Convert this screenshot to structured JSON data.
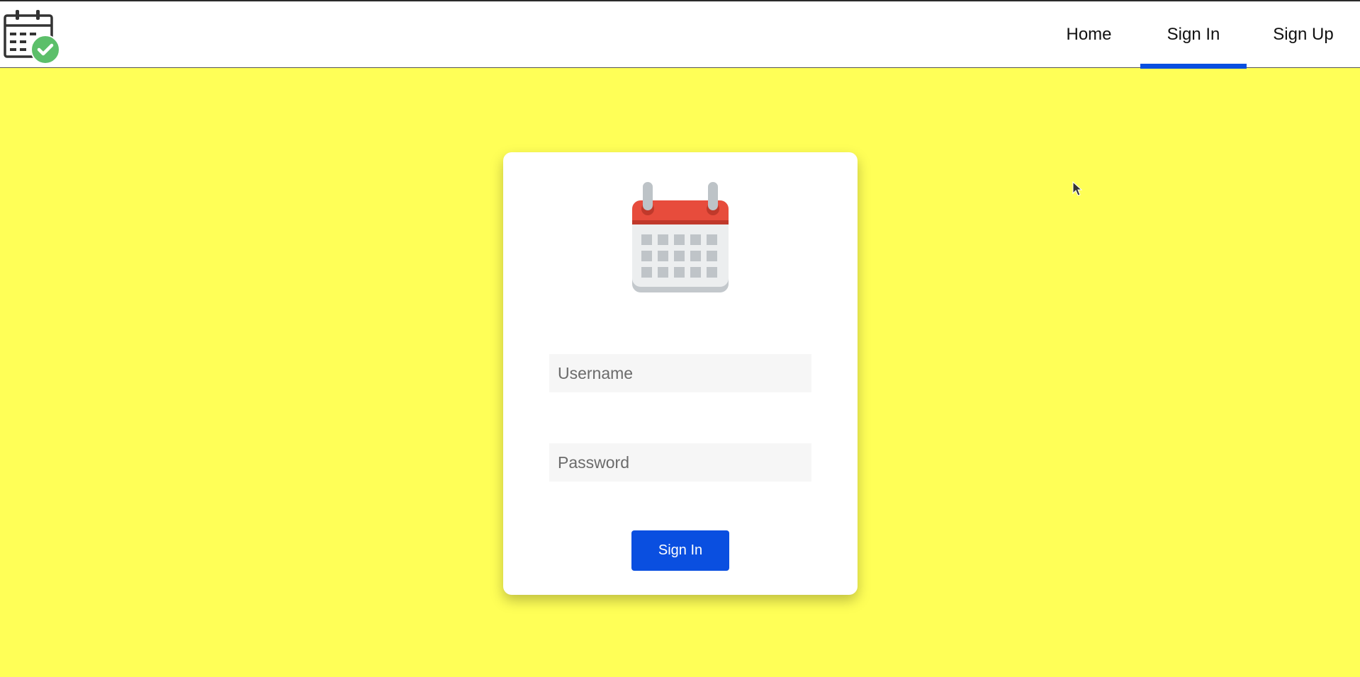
{
  "header": {
    "logo_icon": "calendar-check-icon",
    "nav": {
      "home_label": "Home",
      "signin_label": "Sign In",
      "signup_label": "Sign Up",
      "active": "Sign In"
    }
  },
  "form": {
    "icon": "calendar-icon",
    "username_placeholder": "Username",
    "password_placeholder": "Password",
    "submit_label": "Sign In"
  },
  "colors": {
    "background": "#ffff57",
    "accent": "#0a4fe0",
    "card": "#ffffff"
  }
}
